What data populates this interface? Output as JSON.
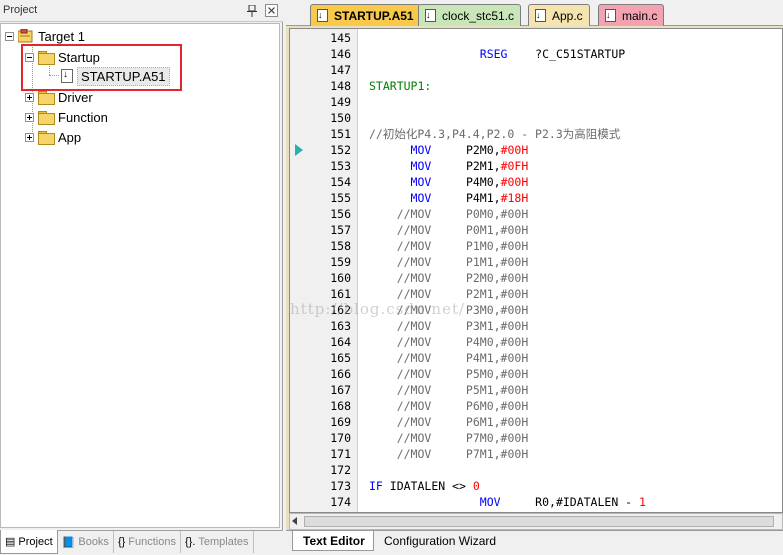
{
  "project_panel": {
    "title": "Project",
    "tree": {
      "root": "Target 1",
      "groups": [
        {
          "name": "Startup",
          "files": [
            "STARTUP.A51"
          ]
        },
        {
          "name": "Driver"
        },
        {
          "name": "Function"
        },
        {
          "name": "App"
        }
      ]
    },
    "bottom_tabs": [
      {
        "label": "Project",
        "icon": "project-icon"
      },
      {
        "label": "Books",
        "icon": "books-icon"
      },
      {
        "label": "Functions",
        "icon": "braces-icon"
      },
      {
        "label": "Templates",
        "icon": "templates-icon"
      }
    ]
  },
  "editor": {
    "file_tabs": [
      {
        "label": "STARTUP.A51",
        "color": "#f8c94a",
        "active": true
      },
      {
        "label": "clock_stc51.c",
        "color": "#c9e6b9"
      },
      {
        "label": "App.c",
        "color": "#f5e4b0"
      },
      {
        "label": "main.c",
        "color": "#f2a2b0"
      }
    ],
    "lines": [
      {
        "n": "145",
        "parts": []
      },
      {
        "n": "146",
        "parts": [
          {
            "t": "                RSEG    ",
            "c": "c-blue"
          },
          {
            "t": "?C_C51STARTUP",
            "c": "c-black"
          }
        ]
      },
      {
        "n": "147",
        "parts": []
      },
      {
        "n": "148",
        "parts": [
          {
            "t": "STARTUP1:",
            "c": "c-green"
          }
        ]
      },
      {
        "n": "149",
        "parts": []
      },
      {
        "n": "150",
        "parts": []
      },
      {
        "n": "151",
        "parts": [
          {
            "t": "//初始化P4.3,P4.4,P2.0 - P2.3为高阻模式",
            "c": "c-gray"
          }
        ]
      },
      {
        "n": "152",
        "parts": [
          {
            "t": "      MOV     ",
            "c": "c-blue"
          },
          {
            "t": "P2M0,",
            "c": "c-black"
          },
          {
            "t": "#00H",
            "c": "c-red"
          }
        ]
      },
      {
        "n": "153",
        "parts": [
          {
            "t": "      MOV     ",
            "c": "c-blue"
          },
          {
            "t": "P2M1,",
            "c": "c-black"
          },
          {
            "t": "#0FH",
            "c": "c-red"
          }
        ]
      },
      {
        "n": "154",
        "parts": [
          {
            "t": "      MOV     ",
            "c": "c-blue"
          },
          {
            "t": "P4M0,",
            "c": "c-black"
          },
          {
            "t": "#00H",
            "c": "c-red"
          }
        ]
      },
      {
        "n": "155",
        "parts": [
          {
            "t": "      MOV     ",
            "c": "c-blue"
          },
          {
            "t": "P4M1,",
            "c": "c-black"
          },
          {
            "t": "#18H",
            "c": "c-red"
          }
        ]
      },
      {
        "n": "156",
        "parts": [
          {
            "t": "    //MOV     P0M0,#00H",
            "c": "c-gray"
          }
        ]
      },
      {
        "n": "157",
        "parts": [
          {
            "t": "    //MOV     P0M1,#00H",
            "c": "c-gray"
          }
        ]
      },
      {
        "n": "158",
        "parts": [
          {
            "t": "    //MOV     P1M0,#00H",
            "c": "c-gray"
          }
        ]
      },
      {
        "n": "159",
        "parts": [
          {
            "t": "    //MOV     P1M1,#00H",
            "c": "c-gray"
          }
        ]
      },
      {
        "n": "160",
        "parts": [
          {
            "t": "    //MOV     P2M0,#00H",
            "c": "c-gray"
          }
        ]
      },
      {
        "n": "161",
        "parts": [
          {
            "t": "    //MOV     P2M1,#00H",
            "c": "c-gray"
          }
        ]
      },
      {
        "n": "162",
        "parts": [
          {
            "t": "    //MOV     P3M0,#00H",
            "c": "c-gray"
          }
        ]
      },
      {
        "n": "163",
        "parts": [
          {
            "t": "    //MOV     P3M1,#00H",
            "c": "c-gray"
          }
        ]
      },
      {
        "n": "164",
        "parts": [
          {
            "t": "    //MOV     P4M0,#00H",
            "c": "c-gray"
          }
        ]
      },
      {
        "n": "165",
        "parts": [
          {
            "t": "    //MOV     P4M1,#00H",
            "c": "c-gray"
          }
        ]
      },
      {
        "n": "166",
        "parts": [
          {
            "t": "    //MOV     P5M0,#00H",
            "c": "c-gray"
          }
        ]
      },
      {
        "n": "167",
        "parts": [
          {
            "t": "    //MOV     P5M1,#00H",
            "c": "c-gray"
          }
        ]
      },
      {
        "n": "168",
        "parts": [
          {
            "t": "    //MOV     P6M0,#00H",
            "c": "c-gray"
          }
        ]
      },
      {
        "n": "169",
        "parts": [
          {
            "t": "    //MOV     P6M1,#00H",
            "c": "c-gray"
          }
        ]
      },
      {
        "n": "170",
        "parts": [
          {
            "t": "    //MOV     P7M0,#00H",
            "c": "c-gray"
          }
        ]
      },
      {
        "n": "171",
        "parts": [
          {
            "t": "    //MOV     P7M1,#00H",
            "c": "c-gray"
          }
        ]
      },
      {
        "n": "172",
        "parts": []
      },
      {
        "n": "173",
        "parts": [
          {
            "t": "IF ",
            "c": "c-blue"
          },
          {
            "t": "IDATALEN <> ",
            "c": "c-black"
          },
          {
            "t": "0",
            "c": "c-red"
          }
        ]
      },
      {
        "n": "174",
        "parts": [
          {
            "t": "                MOV     ",
            "c": "c-blue"
          },
          {
            "t": "R0,#IDATALEN - ",
            "c": "c-black"
          },
          {
            "t": "1",
            "c": "c-red"
          }
        ]
      }
    ],
    "bottom_tabs": [
      {
        "label": "Text Editor",
        "active": true
      },
      {
        "label": "Configuration Wizard"
      }
    ],
    "watermark": "http://blog.csdn.net/"
  }
}
